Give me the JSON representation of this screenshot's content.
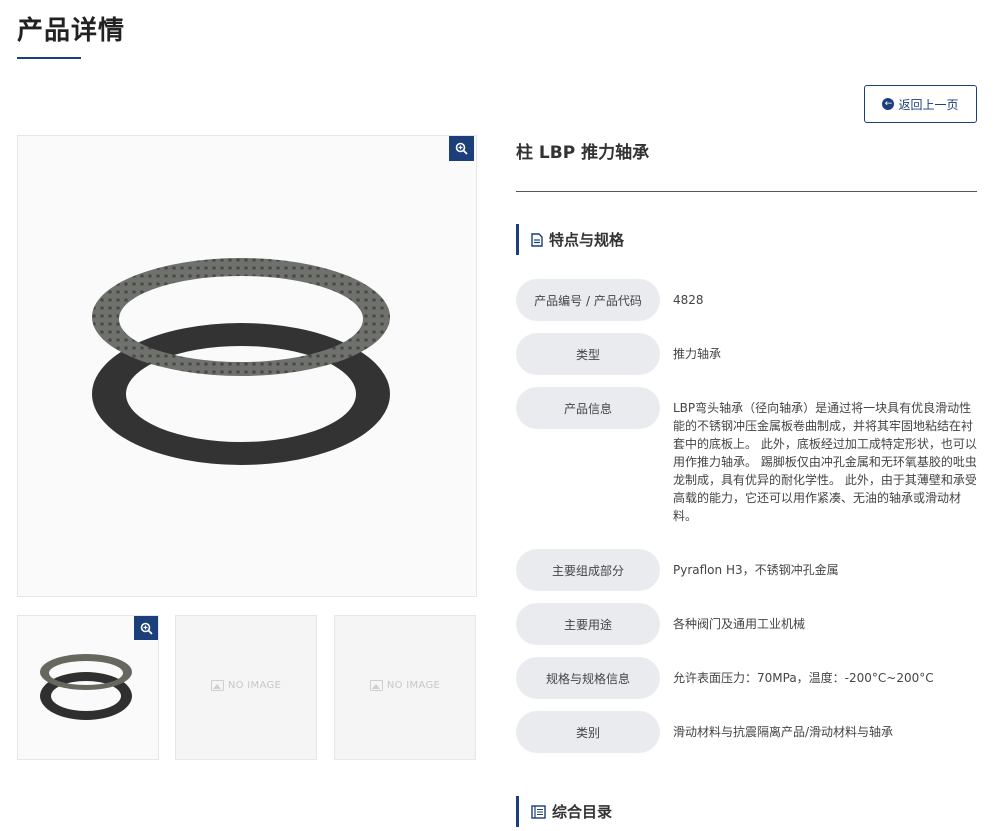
{
  "header": {
    "title": "产品详情"
  },
  "back_button": {
    "label": "返回上一页"
  },
  "product": {
    "name": "柱 LBP 推力轴承"
  },
  "gallery": {
    "no_image_text": "NO IMAGE"
  },
  "specs_section": {
    "title": "特点与规格",
    "rows": [
      {
        "label": "产品编号 / 产品代码",
        "value": "4828"
      },
      {
        "label": "类型",
        "value": "推力轴承"
      },
      {
        "label": "产品信息",
        "value": "LBP弯头轴承（径向轴承）是通过将一块具有优良滑动性能的不锈钢冲压金属板卷曲制成，并将其牢固地粘结在衬套中的底板上。 此外，底板经过加工成特定形状，也可以用作推力轴承。 踢脚板仅由冲孔金属和无环氧基胶的吡虫龙制成，具有优异的耐化学性。 此外，由于其薄壁和承受高载的能力，它还可以用作紧凑、无油的轴承或滑动材料。"
      },
      {
        "label": "主要组成部分",
        "value": "Pyraflon H3，不锈钢冲孔金属"
      },
      {
        "label": "主要用途",
        "value": "各种阀门及通用工业机械"
      },
      {
        "label": "规格与规格信息",
        "value": "允许表面压力：70MPa，温度：-200°C~200°C"
      },
      {
        "label": "类别",
        "value": "滑动材料与抗震隔离产品/滑动材料与轴承"
      }
    ]
  },
  "catalog_section": {
    "title": "综合目录"
  },
  "colors": {
    "accent": "#1a3f7a",
    "label_bg": "#e9ebef"
  }
}
